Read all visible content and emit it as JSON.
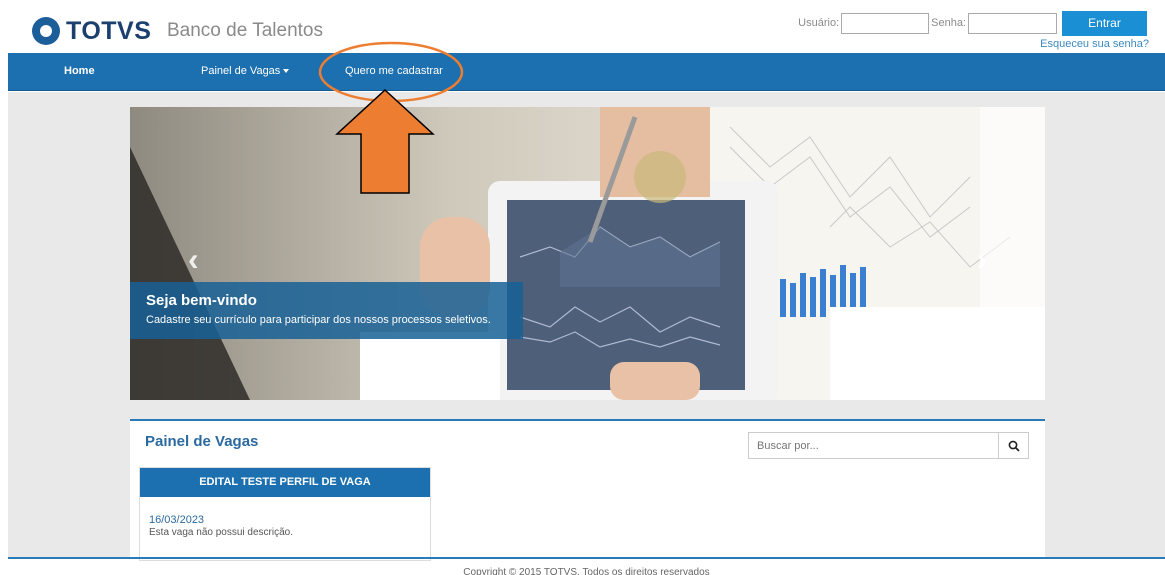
{
  "header": {
    "logo_text": "TOTVS",
    "app_title": "Banco de Talentos",
    "login": {
      "user_label": "Usuário:",
      "user_value": "",
      "pass_label": "Senha:",
      "pass_value": "",
      "submit_label": "Entrar",
      "forgot_label": "Esqueceu sua senha?"
    }
  },
  "nav": {
    "items": [
      {
        "label": "Home",
        "active": true
      },
      {
        "label": "Painel de Vagas",
        "has_dropdown": true
      },
      {
        "label": "Quero me cadastrar",
        "highlighted": true
      }
    ]
  },
  "carousel": {
    "caption_title": "Seja bem-vindo",
    "caption_text": "Cadastre seu currículo para participar dos nossos processos seletivos.",
    "prev_icon": "chevron-left-icon",
    "next_icon": "chevron-right-icon"
  },
  "panel": {
    "title": "Painel de Vagas",
    "search_placeholder": "Buscar por...",
    "search_icon": "search-icon",
    "jobs": [
      {
        "title": "EDITAL TESTE PERFIL DE VAGA",
        "date": "16/03/2023",
        "description": "Esta vaga não possui descrição."
      }
    ]
  },
  "footer": {
    "text": "Copyright © 2015 TOTVS. Todos os direitos reservados"
  },
  "annotation": {
    "color": "#ed7d31",
    "shapes": [
      "ellipse",
      "arrow-up"
    ]
  },
  "colors": {
    "primary": "#1c70b0",
    "button": "#1a8fd3",
    "accent": "#2b6aa0"
  }
}
